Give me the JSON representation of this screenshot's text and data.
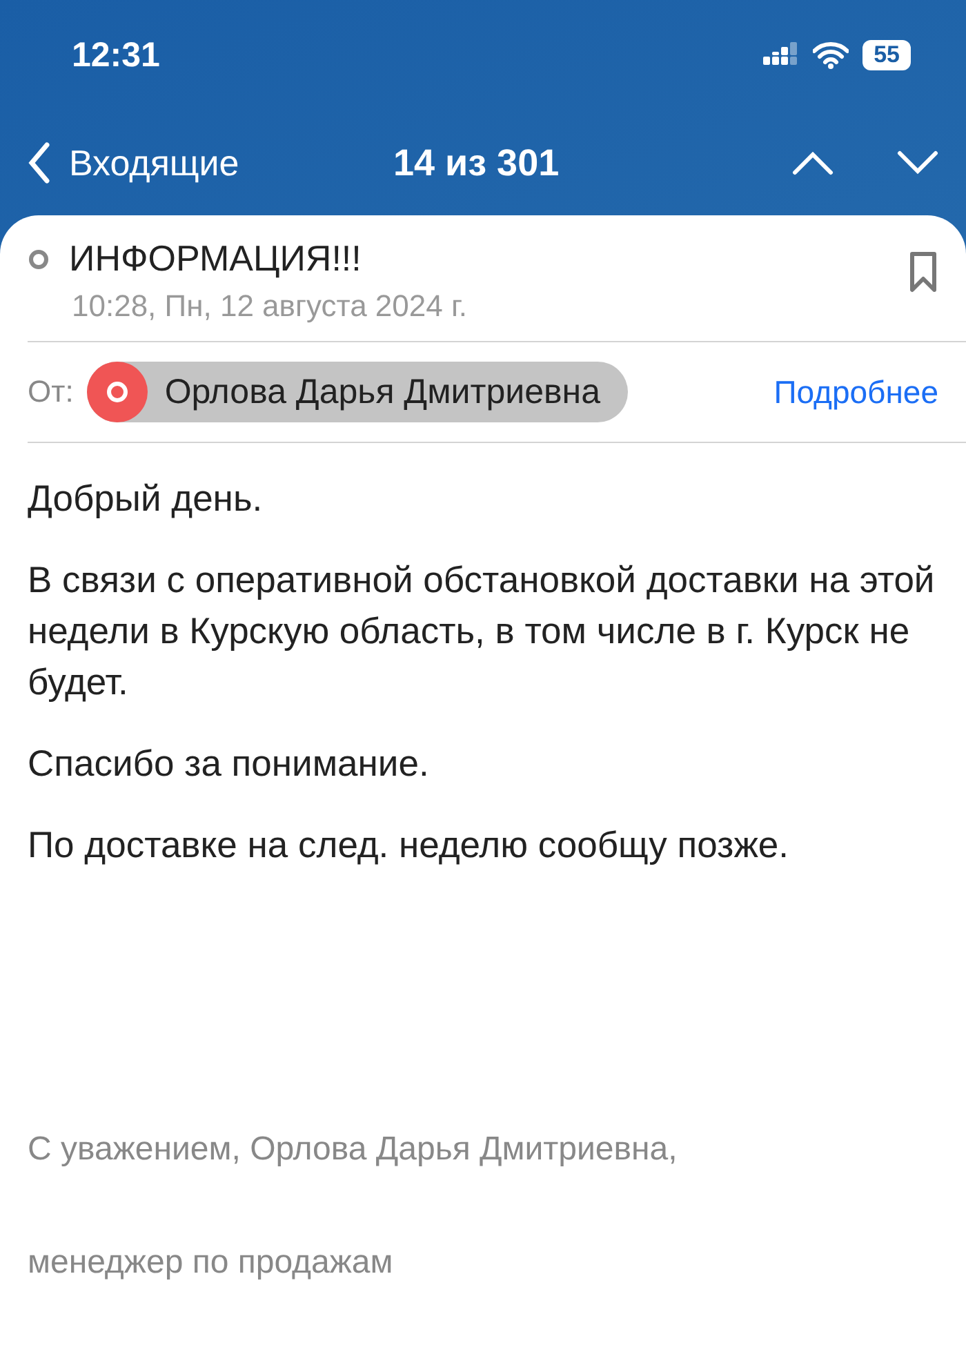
{
  "status_bar": {
    "time": "12:31",
    "battery": "55"
  },
  "nav": {
    "back": "Входящие",
    "position": "14 из 301"
  },
  "message": {
    "subject": "ИНФОРМАЦИЯ!!!",
    "date": "10:28, Пн, 12 августа 2024 г.",
    "from_label": "От:",
    "sender": "Орлова Дарья Дмитриевна",
    "details": "Подробнее",
    "paragraphs": [
      "Добрый день.",
      "В связи с оперативной обстановкой доставки на этой недели в Курскую область, в том числе в г. Курск не будет.",
      "Спасибо за понимание.",
      "По доставке на след. неделю сообщу позже."
    ],
    "signature": [
      "С уважением, Орлова Дарья Дмитриевна,",
      "менеджер по продажам"
    ]
  }
}
